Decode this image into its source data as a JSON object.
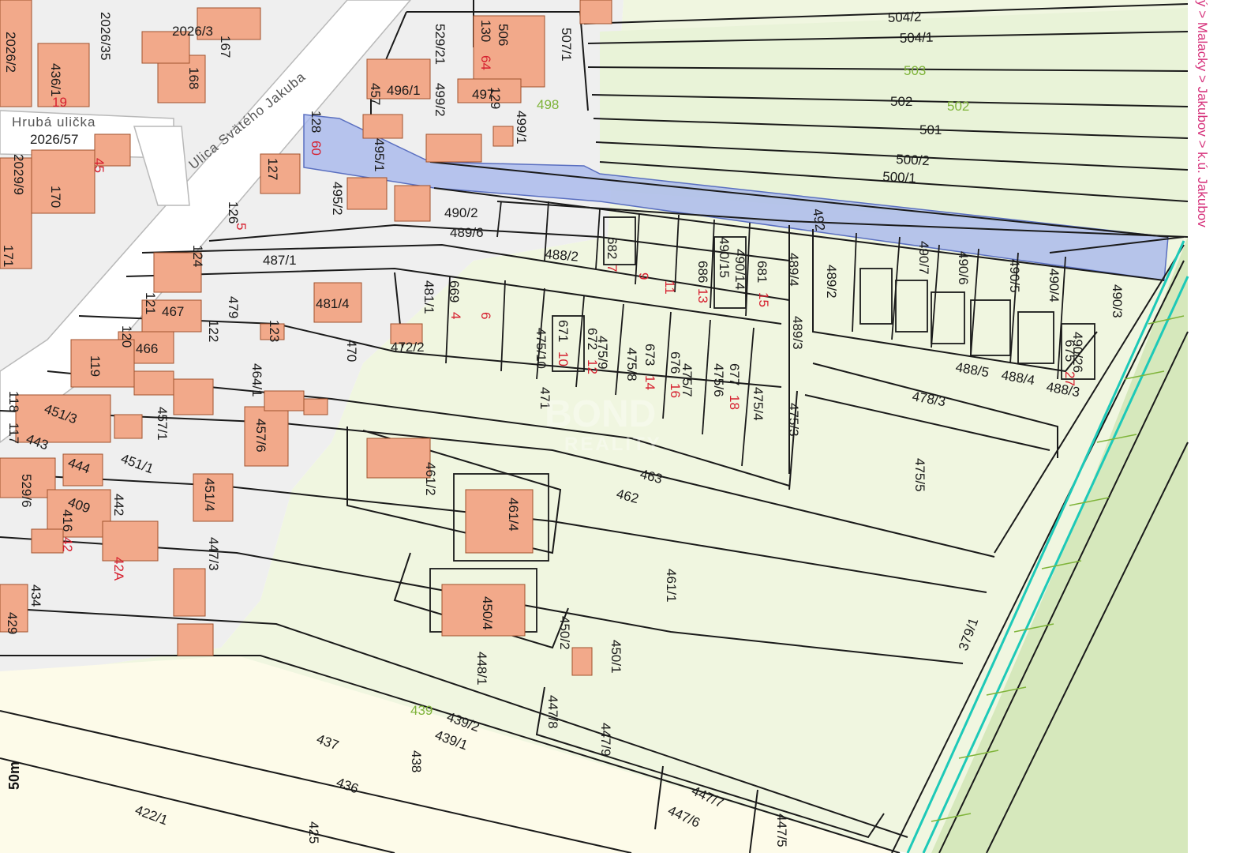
{
  "map": {
    "breadcrumb": "ý > Malacky > Jakubov > k.ú. Jakubov",
    "scale_label": "50m",
    "watermark": {
      "line1": "BOND",
      "line2": "REALITY"
    },
    "colors": {
      "background": "#ffffff",
      "built_area": "#efefef",
      "parcel_fill": "#f0f6e0",
      "field_fill": "#e6f2d2",
      "meadow_fill": "#d6e8bc",
      "building": "#f2a98a",
      "highlight": "#a8b8ec",
      "line": "#1a1a1a",
      "stream": "#1dc9b8",
      "breadcrumb": "#d6337c",
      "red_label": "#d6202f",
      "green_label": "#7fb43a"
    },
    "streets": [
      "Ulica Svätého Jakuba",
      "Hrubá ulička"
    ],
    "parcel_labels": [
      "504/2",
      "504/1",
      "503",
      "502",
      "501",
      "500/2",
      "500/1",
      "492",
      "490/2",
      "489/6",
      "488/2",
      "487/1",
      "479",
      "481/4",
      "481/1",
      "470",
      "472/2",
      "466",
      "467",
      "464/1",
      "457/1",
      "457/6",
      "451/3",
      "451/1",
      "451/4",
      "444",
      "443",
      "434",
      "429",
      "447/3",
      "461/2",
      "461/4",
      "463",
      "462",
      "461/1",
      "450/4",
      "450/2",
      "450/1",
      "448/1",
      "447/8",
      "447/9",
      "447/7",
      "447/6",
      "447/5",
      "439/2",
      "439/1",
      "438",
      "437",
      "436",
      "425",
      "422/1",
      "475/5",
      "478/3",
      "488/5",
      "488/4",
      "488/3",
      "490/3",
      "490/4",
      "490/5",
      "490/6",
      "490/7",
      "489/2",
      "489/4",
      "489/3",
      "475/4",
      "475/3",
      "475/6",
      "475/7",
      "475/8",
      "475/9",
      "475/10",
      "471",
      "669",
      "682",
      "686",
      "490/15",
      "490/14",
      "681",
      "671",
      "672",
      "673",
      "676",
      "677",
      "675",
      "490/26",
      "379/1",
      "529/21",
      "529/6",
      "506",
      "507/1",
      "499/2",
      "499/1",
      "495/1",
      "495/2",
      "496/1",
      "497",
      "498",
      "457",
      "2026/3",
      "2026/35",
      "2026/57",
      "2029/9",
      "2026/2",
      "436/1",
      "168",
      "167",
      "170",
      "171",
      "124",
      "121",
      "122",
      "123",
      "120",
      "119",
      "118",
      "117",
      "128",
      "127",
      "126",
      "129",
      "130",
      "442",
      "409",
      "416"
    ],
    "red_labels": [
      "19",
      "45",
      "60",
      "64",
      "5",
      "6",
      "4",
      "7",
      "9",
      "11",
      "13",
      "15",
      "10",
      "12",
      "14",
      "16",
      "18",
      "27",
      "42",
      "42A"
    ],
    "green_labels": [
      "503",
      "502",
      "498",
      "439"
    ]
  }
}
